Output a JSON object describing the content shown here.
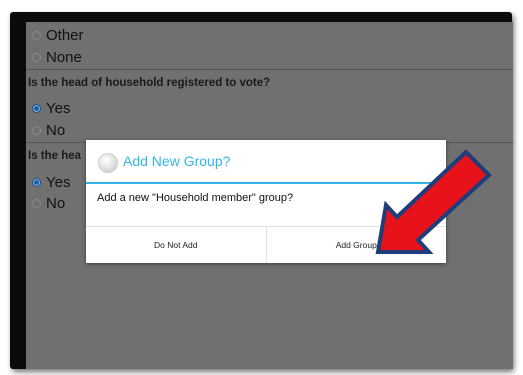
{
  "form": {
    "q1_options": [
      {
        "label": "Other",
        "checked": false
      },
      {
        "label": "None",
        "checked": false
      }
    ],
    "q2": {
      "question": "Is the head of household registered to vote?",
      "options": [
        {
          "label": "Yes",
          "checked": true
        },
        {
          "label": "No",
          "checked": false
        }
      ]
    },
    "q3": {
      "question_visible": "Is the hea",
      "options": [
        {
          "label": "Yes",
          "checked": true
        },
        {
          "label": "No",
          "checked": false
        }
      ]
    }
  },
  "dialog": {
    "title": "Add New Group?",
    "message": "Add a new \"Household member\" group?",
    "cancel_label": "Do Not Add",
    "confirm_label": "Add Group"
  },
  "colors": {
    "accent": "#33b5e5",
    "arrow_fill": "#e8131a",
    "arrow_outline": "#1f3d7a",
    "overlay": "#707070"
  },
  "icons": {
    "dialog_icon": "app-icon",
    "annotation": "red-arrow-icon"
  }
}
